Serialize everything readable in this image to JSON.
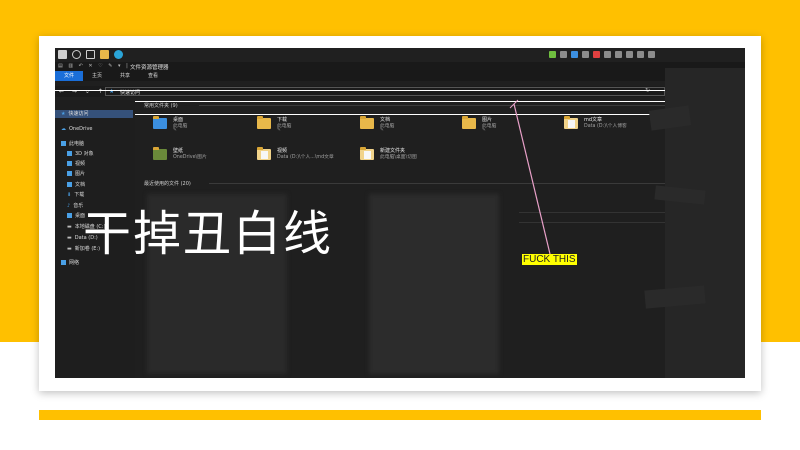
{
  "colors": {
    "accent": "#FFC000",
    "explorer_bg": "#1f1f1f",
    "ribbon_active": "#1a6ed8",
    "annotation_line": "#e8a0c8",
    "callout_bg": "#ffff00"
  },
  "explorer": {
    "title": "文件资源管理器",
    "ribbon_tabs": [
      "文件",
      "主页",
      "共享",
      "查看"
    ],
    "address": "快速访问"
  },
  "sidebar": {
    "items": [
      {
        "label": "快速访问",
        "icon": "star-icon"
      },
      {
        "label": "OneDrive",
        "icon": "cloud-icon"
      },
      {
        "label": "此电脑",
        "icon": "computer-icon"
      },
      {
        "label": "3D 对象",
        "icon": "cube-icon"
      },
      {
        "label": "视频",
        "icon": "video-icon"
      },
      {
        "label": "图片",
        "icon": "image-icon"
      },
      {
        "label": "文档",
        "icon": "document-icon"
      },
      {
        "label": "下载",
        "icon": "download-icon"
      },
      {
        "label": "音乐",
        "icon": "music-icon"
      },
      {
        "label": "桌面",
        "icon": "desktop-icon"
      },
      {
        "label": "本地磁盘 (C:)",
        "icon": "drive-icon"
      },
      {
        "label": "Data (D:)",
        "icon": "drive-icon"
      },
      {
        "label": "新加卷 (E:)",
        "icon": "drive-icon"
      },
      {
        "label": "网络",
        "icon": "network-icon"
      }
    ]
  },
  "frequent": {
    "header": "常用文件夹 (9)",
    "folders": [
      {
        "name": "桌面",
        "location": "此电脑"
      },
      {
        "name": "下载",
        "location": "此电脑"
      },
      {
        "name": "文档",
        "location": "此电脑"
      },
      {
        "name": "图片",
        "location": "此电脑"
      },
      {
        "name": "md文章",
        "location": "Data (D:)\\个人博客"
      },
      {
        "name": "壁纸",
        "location": "OneDrive\\图片"
      },
      {
        "name": "视频",
        "location": "Data (D:)\\个人...\\md文章"
      },
      {
        "name": "新建文件夹",
        "location": "此电脑\\桌面\\切图"
      }
    ]
  },
  "recent": {
    "header": "最近使用的文件 (20)"
  },
  "overlay": {
    "big_text": "干掉丑白线",
    "callout": "FUCK THIS"
  }
}
